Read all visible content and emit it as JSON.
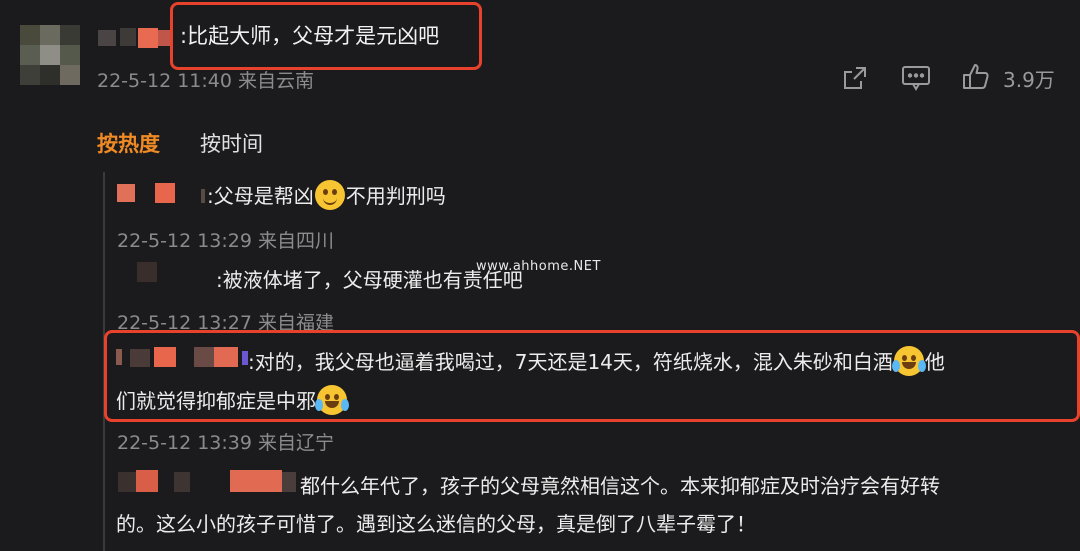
{
  "top_comment": {
    "text": ":比起大师，父母才是元凶吧",
    "meta": "22-5-12 11:40 来自云南",
    "likes": "3.9万",
    "icons": {
      "share": "share-icon",
      "comment": "comment-icon",
      "like": "thumbs-up-icon"
    }
  },
  "tabs": {
    "hot": "按热度",
    "time": "按时间"
  },
  "replies": [
    {
      "text_before": ":父母是帮凶",
      "emoji": "smile-emoji",
      "text_after": "不用判刑吗",
      "meta": "22-5-12 13:29 来自四川"
    },
    {
      "text": ":被液体堵了，父母硬灌也有责任吧",
      "meta": "22-5-12 13:27 来自福建"
    },
    {
      "line1_before": ":对的，我父母也逼着我喝过，7天还是14天，符纸烧水，混入朱砂和白酒",
      "line1_after": "他",
      "line2_before": "们就觉得抑郁症是中邪",
      "emoji": "laugh-cry-emoji",
      "meta": "22-5-12 13:39 来自辽宁"
    },
    {
      "line1": "都什么年代了，孩子的父母竟然相信这个。本来抑郁症及时治疗会有好转",
      "line2": "的。这么小的孩子可惜了。遇到这么迷信的父母，真是倒了八辈子霉了！"
    }
  ],
  "watermark": "www.ahhome.NET",
  "colors": {
    "background": "#1b1b1d",
    "accent": "#f08a24",
    "highlight": "#e8412c",
    "meta": "#8b8b8b"
  }
}
